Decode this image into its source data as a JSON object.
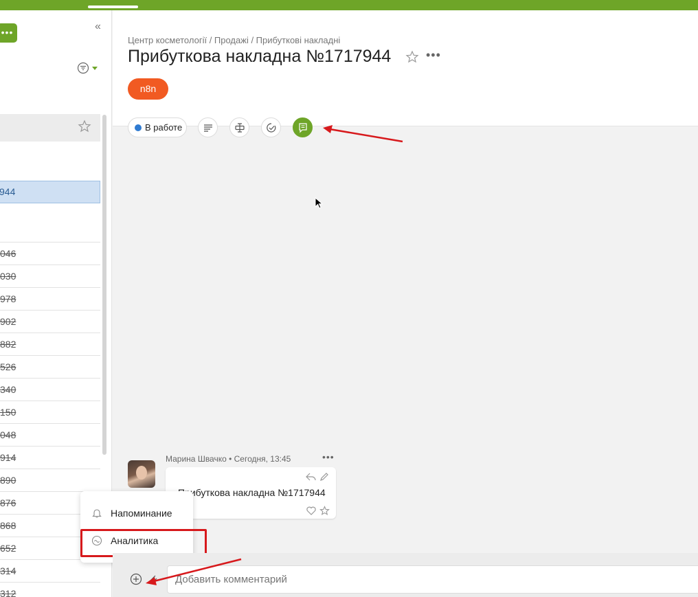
{
  "breadcrumb": "Центр косметології / Продажі / Прибуткові накладні",
  "title": "Прибуткова накладна №1717944",
  "tag": "n8n",
  "status": {
    "label": "В работе",
    "color": "#2f7bd1"
  },
  "sidebar": {
    "selected_item": "944",
    "rows": [
      "046",
      "030",
      "978",
      "902",
      "882",
      "526",
      "340",
      "150",
      "048",
      "914",
      "890",
      "876",
      "868",
      "652",
      "314",
      "312"
    ]
  },
  "comment": {
    "author_time": "Марина Швачко • Сегодня, 13:45",
    "text": "Прибуткова накладна №1717944"
  },
  "popup": {
    "items": [
      "Напоминание",
      "Аналитика"
    ]
  },
  "comment_input": {
    "placeholder": "Добавить комментарий"
  },
  "colors": {
    "brand": "#6ea528",
    "tag": "#f15a22",
    "annotation": "#d7191c"
  }
}
